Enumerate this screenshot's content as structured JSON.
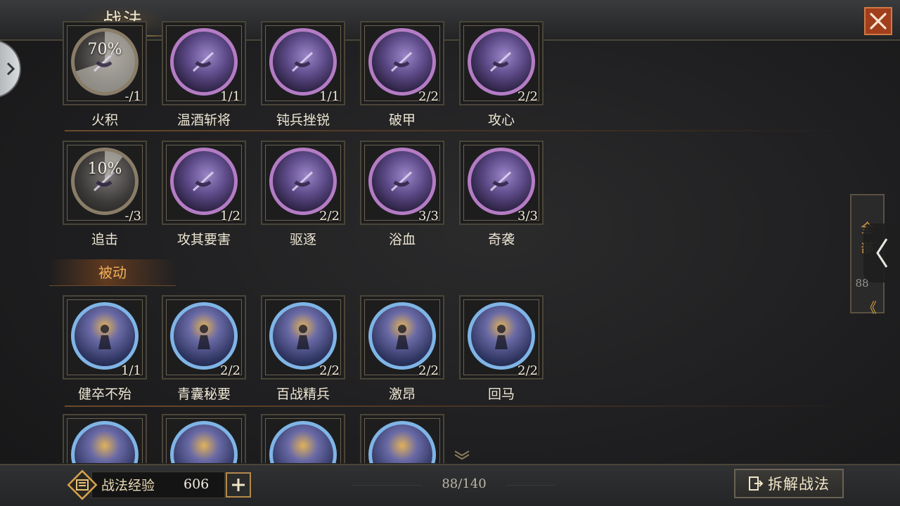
{
  "header": {
    "title": "战法"
  },
  "active_rows": [
    {
      "cards": [
        {
          "name": "火积",
          "count": "-/1",
          "percent": "70%",
          "locked": true,
          "progress": 0.7
        },
        {
          "name": "温酒斩将",
          "count": "1/1"
        },
        {
          "name": "钝兵挫锐",
          "count": "1/1"
        },
        {
          "name": "破甲",
          "count": "2/2"
        },
        {
          "name": "攻心",
          "count": "2/2"
        }
      ]
    },
    {
      "cards": [
        {
          "name": "追击",
          "count": "-/3",
          "percent": "10%",
          "locked": true,
          "progress": 0.1
        },
        {
          "name": "攻其要害",
          "count": "1/2"
        },
        {
          "name": "驱逐",
          "count": "2/2"
        },
        {
          "name": "浴血",
          "count": "3/3"
        },
        {
          "name": "奇袭",
          "count": "3/3"
        }
      ]
    }
  ],
  "passive_section": {
    "label": "被动"
  },
  "passive_rows": [
    {
      "cards": [
        {
          "name": "健卒不殆",
          "count": "1/1"
        },
        {
          "name": "青囊秘要",
          "count": "2/2"
        },
        {
          "name": "百战精兵",
          "count": "2/2"
        },
        {
          "name": "激昂",
          "count": "2/2"
        },
        {
          "name": "回马",
          "count": "2/2"
        }
      ]
    }
  ],
  "filter": {
    "label_line1": "全",
    "label_line2": "部",
    "count": "88",
    "chevron": "《"
  },
  "footer": {
    "exp_label": "战法经验",
    "exp_value": "606",
    "capacity": "88/140",
    "dismantle_label": "拆解战法"
  },
  "icons": {
    "close": "close-icon",
    "exp": "exp-icon",
    "plus": "plus-icon",
    "dismantle": "dismantle-icon",
    "collapse": "chevron-left-icon",
    "side_knob": "chevron-right-icon"
  }
}
